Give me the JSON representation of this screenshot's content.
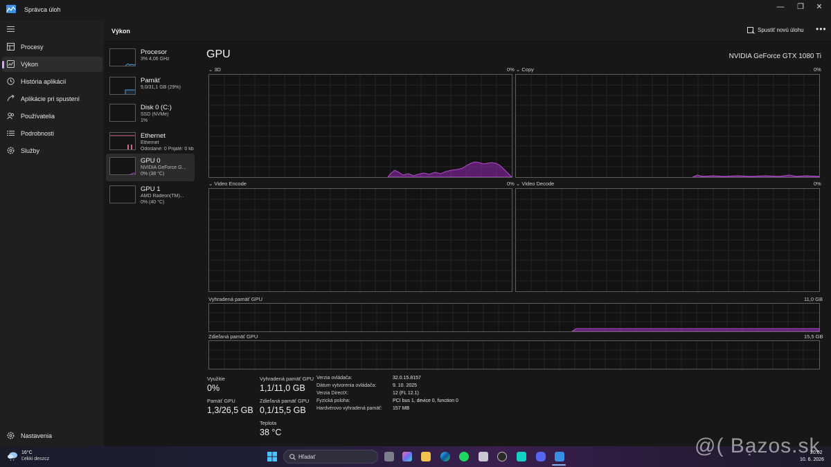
{
  "window": {
    "title": "Správca úloh"
  },
  "nav": {
    "items": [
      {
        "label": "Procesy",
        "icon": "processes-icon"
      },
      {
        "label": "Výkon",
        "icon": "performance-icon"
      },
      {
        "label": "História aplikácií",
        "icon": "history-icon"
      },
      {
        "label": "Aplikácie pri spustení",
        "icon": "startup-icon"
      },
      {
        "label": "Používatelia",
        "icon": "users-icon"
      },
      {
        "label": "Podrobnosti",
        "icon": "details-icon"
      },
      {
        "label": "Služby",
        "icon": "services-icon"
      }
    ],
    "settings": "Nastavenia"
  },
  "header": {
    "title": "Výkon",
    "new_task": "Spustiť novú úlohu"
  },
  "devices": [
    {
      "name": "Procesor",
      "sub1": "3% 4,06 GHz",
      "sub2": "",
      "sub3": ""
    },
    {
      "name": "Pamäť",
      "sub1": "9,0/31,1 GB (29%)",
      "sub2": "",
      "sub3": ""
    },
    {
      "name": "Disk 0 (C:)",
      "sub1": "SSD (NVMe)",
      "sub2": "1%",
      "sub3": ""
    },
    {
      "name": "Ethernet",
      "sub1": "Ethernet",
      "sub2": "Odoslané: 0 Prijaté: 0 kb",
      "sub3": ""
    },
    {
      "name": "GPU 0",
      "sub1": "NVIDIA GeForce G...",
      "sub2": "0% (38 °C)",
      "sub3": ""
    },
    {
      "name": "GPU 1",
      "sub1": "AMD Radeon(TM)...",
      "sub2": "0% (40 °C)",
      "sub3": ""
    }
  ],
  "gpu": {
    "title": "GPU",
    "model": "NVIDIA GeForce GTX 1080 Ti",
    "graphs": {
      "g3d": {
        "label": "3D",
        "value": "0%"
      },
      "copy": {
        "label": "Copy",
        "value": "0%"
      },
      "encode": {
        "label": "Video Encode",
        "value": "0%"
      },
      "decode": {
        "label": "Video Decode",
        "value": "0%"
      },
      "dedicated": {
        "label": "Vyhradená pamäť GPU",
        "value": "11,0 GB"
      },
      "shared": {
        "label": "Zdieľaná pamäť GPU",
        "value": "15,5 GB"
      }
    },
    "stats": {
      "util_label": "Využitie",
      "util_value": "0%",
      "gpumem_label": "Pamäť GPU",
      "gpumem_value": "1,3/26,5 GB",
      "ded_label": "Vyhradená pamäť GPU",
      "ded_value": "1,1/11,0 GB",
      "shared_label": "Zdieľaná pamäť GPU",
      "shared_value": "0,1/15,5 GB",
      "temp_label": "Teplota",
      "temp_value": "38 °C"
    },
    "info": [
      {
        "k": "Verzia ovládača:",
        "v": "32.0.15.8157"
      },
      {
        "k": "Dátum vytvorenia ovládača:",
        "v": "9. 10. 2025"
      },
      {
        "k": "Verzia DirectX:",
        "v": "12 (FL 12.1)"
      },
      {
        "k": "Fyzická poloha:",
        "v": "PCI bus 1, device 0, function 0"
      },
      {
        "k": "Hardvérovo vyhradená pamäť:",
        "v": "157 MB"
      }
    ]
  },
  "taskbar": {
    "weather_temp": "16°C",
    "weather_desc": "Ľekki deszcz",
    "search_placeholder": "Hľadať",
    "time": "20:02",
    "date": "10. 6. 2026"
  },
  "watermark": "@( Bazos.sk",
  "colors": {
    "accent": "#d8a6ff",
    "gpu_line": "#b44cd0",
    "cpu_line": "#4aa3df",
    "eth_line": "#d46a8a"
  }
}
